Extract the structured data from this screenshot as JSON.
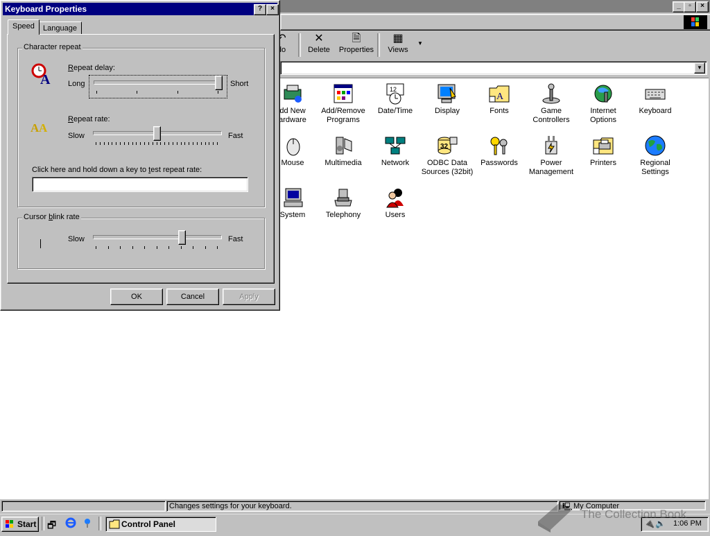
{
  "control_panel": {
    "caption_buttons": [
      "_",
      "▫",
      "×"
    ],
    "toolbar": {
      "undo_fragment": "do",
      "delete": "Delete",
      "properties": "Properties",
      "views": "Views"
    },
    "items": [
      {
        "label_line1": "Add New",
        "label_line2": "Hardware",
        "shown1": "dd New",
        "shown2": "ardware",
        "icon": "hardware-icon"
      },
      {
        "label_line1": "Add/Remove",
        "label_line2": "Programs",
        "icon": "add-remove-programs-icon"
      },
      {
        "label_line1": "Date/Time",
        "label_line2": "",
        "icon": "date-time-icon"
      },
      {
        "label_line1": "Display",
        "label_line2": "",
        "icon": "display-icon"
      },
      {
        "label_line1": "Fonts",
        "label_line2": "",
        "icon": "fonts-folder-icon"
      },
      {
        "label_line1": "Game",
        "label_line2": "Controllers",
        "icon": "joystick-icon"
      },
      {
        "label_line1": "Internet",
        "label_line2": "Options",
        "icon": "internet-options-icon"
      },
      {
        "label_line1": "Keyboard",
        "label_line2": "",
        "icon": "keyboard-icon"
      },
      {
        "label_line1": "Mouse",
        "label_line2": "",
        "icon": "mouse-icon"
      },
      {
        "label_line1": "Multimedia",
        "label_line2": "",
        "icon": "multimedia-icon"
      },
      {
        "label_line1": "Network",
        "label_line2": "",
        "icon": "network-icon"
      },
      {
        "label_line1": "ODBC Data",
        "label_line2": "Sources (32bit)",
        "icon": "odbc-icon"
      },
      {
        "label_line1": "Passwords",
        "label_line2": "",
        "icon": "keys-icon"
      },
      {
        "label_line1": "Power",
        "label_line2": "Management",
        "icon": "power-icon"
      },
      {
        "label_line1": "Printers",
        "label_line2": "",
        "icon": "printers-folder-icon"
      },
      {
        "label_line1": "Regional",
        "label_line2": "Settings",
        "icon": "globe-icon"
      },
      {
        "label_line1": "System",
        "label_line2": "",
        "icon": "computer-icon"
      },
      {
        "label_line1": "Telephony",
        "label_line2": "",
        "icon": "telephone-icon"
      },
      {
        "label_line1": "Users",
        "label_line2": "",
        "icon": "users-icon"
      }
    ],
    "status": {
      "message": "Changes settings for your keyboard.",
      "zone": "My Computer"
    }
  },
  "dialog": {
    "title": "Keyboard Properties",
    "help_button": "?",
    "close_button": "×",
    "tabs": [
      "Speed",
      "Language"
    ],
    "character_repeat": {
      "group_label": "Character repeat",
      "repeat_delay_label": "Repeat delay:",
      "delay_low": "Long",
      "delay_high": "Short",
      "delay_value": 1.0,
      "repeat_rate_label": "Repeat rate:",
      "rate_low": "Slow",
      "rate_high": "Fast",
      "rate_value": 0.49,
      "test_label": "Click here and hold down a key to test repeat rate:",
      "test_value": ""
    },
    "cursor_blink": {
      "group_label": "Cursor blink rate",
      "low": "Slow",
      "high": "Fast",
      "value": 0.7
    },
    "buttons": {
      "ok": "OK",
      "cancel": "Cancel",
      "apply": "Apply"
    }
  },
  "taskbar": {
    "start": "Start",
    "task": "Control Panel",
    "clock": "1:06 PM"
  },
  "watermark": "The Collection Book"
}
